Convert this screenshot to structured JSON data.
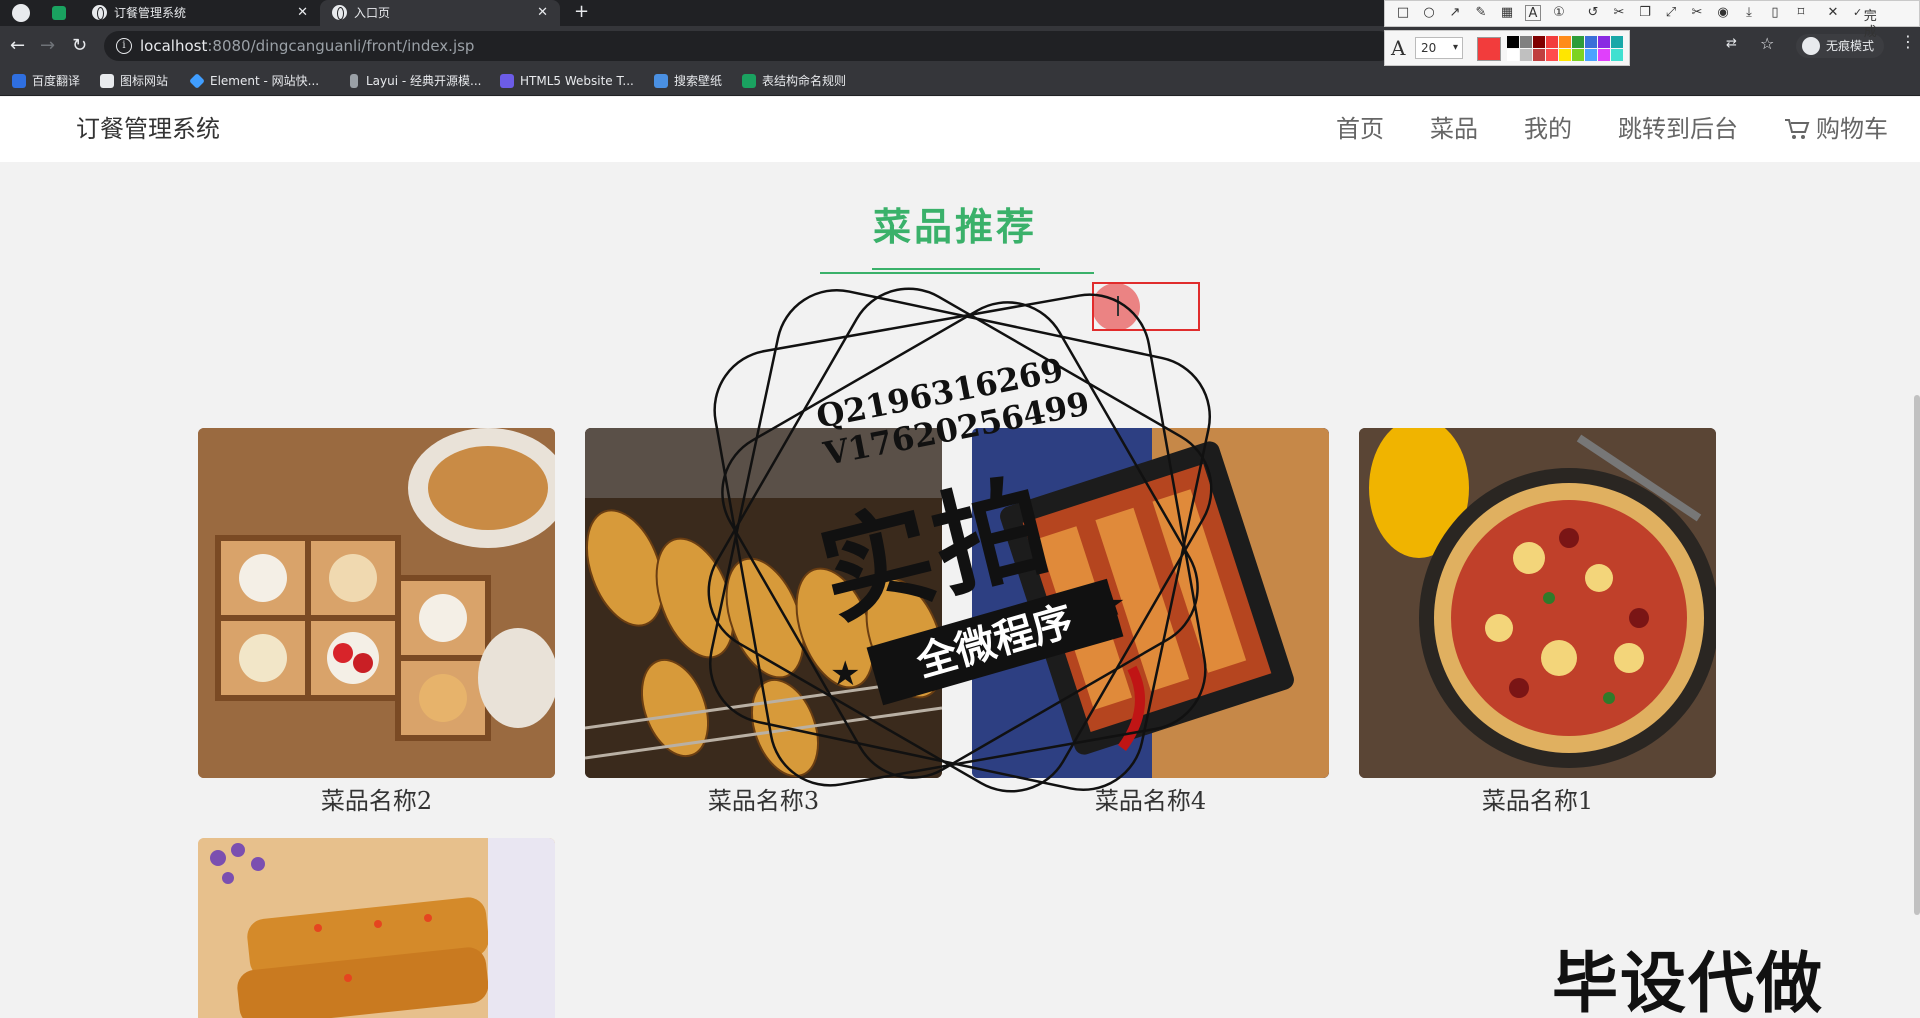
{
  "browser": {
    "tabs": [
      {
        "title": "订餐管理系统",
        "active": false
      },
      {
        "title": "入口页",
        "active": true
      }
    ],
    "new_tab_symbol": "+",
    "url_host": "localhost",
    "url_rest": ":8080/dingcanguanli/front/index.jsp",
    "incognito_label": "无痕模式",
    "bookmarks": [
      {
        "label": "百度翻译",
        "color": "#2f6fe0"
      },
      {
        "label": "图标网站",
        "color": "#e8eaed"
      },
      {
        "label": "Element - 网站快...",
        "color": "#409eff"
      },
      {
        "label": "Layui - 经典开源模...",
        "color": "#9aa0a6"
      },
      {
        "label": "HTML5 Website T...",
        "color": "#6c5ce7"
      },
      {
        "label": "搜索壁纸",
        "color": "#4a90e2"
      },
      {
        "label": "表结构命名规则",
        "color": "#1aa260"
      }
    ]
  },
  "screenshot_tool": {
    "font_size": "20",
    "done_label": "完成",
    "current_color": "#f23c3c",
    "palette": [
      "#000000",
      "#808080",
      "#800000",
      "#f23c3c",
      "#ff8c1a",
      "#2e9c3a",
      "#3a6fd8",
      "#8a2be2",
      "#19a8a8",
      "#ffffff",
      "#c0c0c0",
      "#c04040",
      "#ff4d4d",
      "#ffe600",
      "#7ed321",
      "#4aa3ff",
      "#e040fb",
      "#40e0d0"
    ]
  },
  "site": {
    "brand": "订餐管理系统",
    "nav": [
      "首页",
      "菜品",
      "我的",
      "跳转到后台",
      "购物车"
    ],
    "section_title": "菜品推荐",
    "dishes": [
      {
        "name": "菜品名称2"
      },
      {
        "name": "菜品名称3"
      },
      {
        "name": "菜品名称4"
      },
      {
        "name": "菜品名称1"
      },
      {
        "name": ""
      }
    ]
  },
  "watermark": {
    "qq": "Q2196316269",
    "vx": "V17620256499",
    "big": "实拍",
    "ribbon": "全微程序",
    "corner": "毕设代做"
  }
}
